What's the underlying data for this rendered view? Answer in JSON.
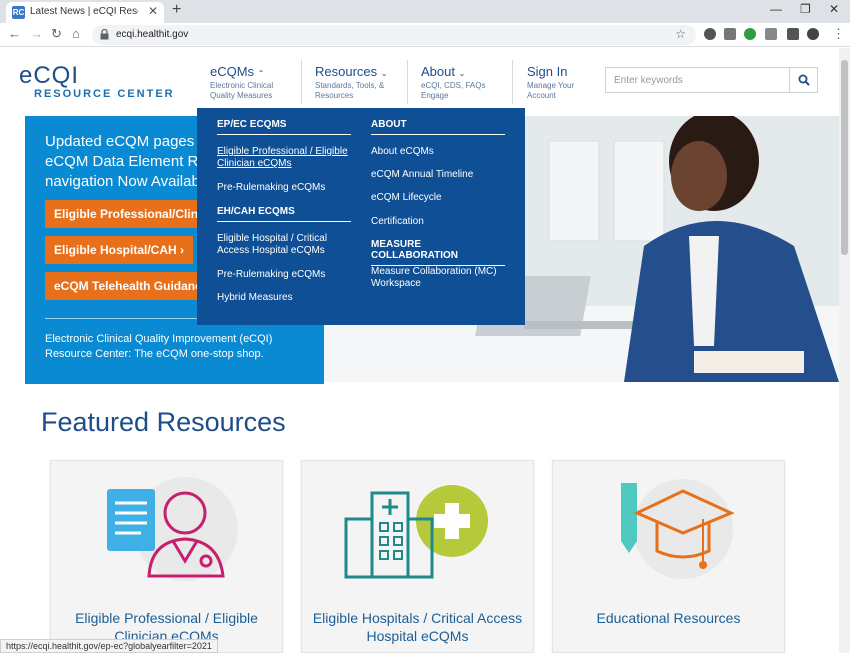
{
  "browser": {
    "tab_title": "Latest News | eCQI Resource Center",
    "favicon_text": "RC",
    "url": "ecqi.healthit.gov",
    "status_url": "https://ecqi.healthit.gov/ep-ec?globalyearfilter=2021"
  },
  "header": {
    "logo_main": "eCQI",
    "logo_sub": "RESOURCE CENTER",
    "nav": [
      {
        "title": "eCQMs",
        "sub": "Electronic Clinical Quality Measures"
      },
      {
        "title": "Resources",
        "sub": "Standards, Tools, & Resources"
      },
      {
        "title": "About",
        "sub": "eCQI, CDS, FAQs Engage"
      },
      {
        "title": "Sign In",
        "sub": "Manage Your Account"
      }
    ],
    "search_placeholder": "Enter keywords"
  },
  "dropdown": {
    "col1_head1": "EP/EC eCQMs",
    "col1_links1": [
      "Eligible Professional / Eligible Clinician eCQMs",
      "Pre-Rulemaking eCQMs"
    ],
    "col1_head2": "EH/CAH eCQMs",
    "col1_links2": [
      "Eligible Hospital / Critical Access Hospital eCQMs",
      "Pre-Rulemaking eCQMs",
      "Hybrid Measures"
    ],
    "col2_head1": "About",
    "col2_links1": [
      "About eCQMs",
      "eCQM Annual Timeline",
      "eCQM Lifecycle",
      "Certification"
    ],
    "col2_head2": "Measure Collaboration",
    "col2_links2": [
      "Measure Collaboration (MC) Workspace"
    ]
  },
  "hero": {
    "heading": "Updated eCQM pages and\neCQM Data Element Repository\nnavigation Now Available",
    "buttons": [
      "Eligible Professional/Clinician",
      "Eligible Hospital/CAH",
      "eCQM Telehealth Guidance Now"
    ],
    "description": "Electronic Clinical Quality Improvement (eCQI) Resource Center: The eCQM one-stop shop."
  },
  "featured": {
    "title": "Featured Resources",
    "cards": [
      {
        "label": "Eligible Professional / Eligible Clinician eCQMs"
      },
      {
        "label": "Eligible Hospitals / Critical Access Hospital eCQMs"
      },
      {
        "label": "Educational Resources"
      }
    ]
  },
  "colors": {
    "brand_blue": "#1d4e89",
    "hero_blue": "#0a8ad2",
    "dropdown_blue": "#0f4f95",
    "orange": "#e8701a"
  }
}
